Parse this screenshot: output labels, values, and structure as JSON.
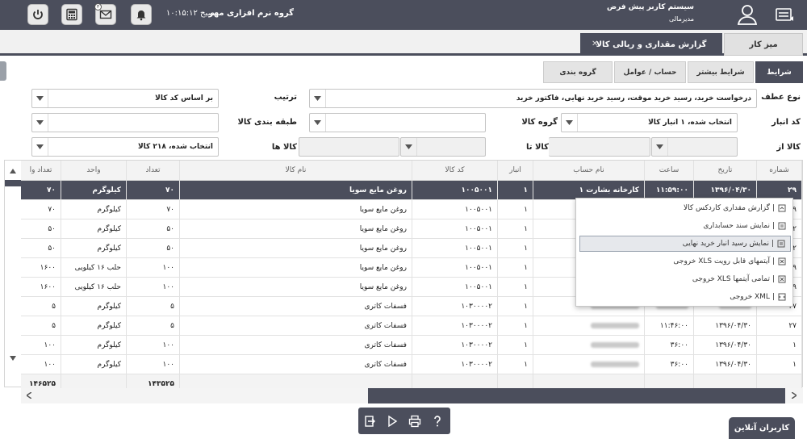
{
  "topbar": {
    "system_name": "سیستم کاربر پیش فرض",
    "role": "مدیرمالی",
    "company": "گروه نرم افزاری مهر",
    "clock": "۱۰:۱۵:۱۲ صبح",
    "mail_badge": "۳",
    "icons": [
      "power-icon",
      "calculator-icon",
      "mail-icon",
      "bell-icon",
      "user-icon",
      "menu-icon"
    ]
  },
  "tabs": {
    "desk": "میز کار",
    "report": "گزارش مقداری و ریالی کالا"
  },
  "subtabs": {
    "conditions": "شرایط",
    "more_conditions": "شرایط بیشتر",
    "accounts": "حساب / عوامل",
    "grouping": "گروه بندی"
  },
  "filters": {
    "reference_type_label": "نوع عطف",
    "reference_type_value": "درخواست خرید، رسید خرید موقت، رسید خرید نهایی، فاکتور خرید",
    "sort_label": "ترتیب",
    "sort_value": "بر اساس کد کالا",
    "warehouse_label": "کد انبار",
    "warehouse_value": "انتخاب شده، ۱ انبار کالا",
    "group_label": "گروه کالا",
    "category_label": "طبقه بندی کالا",
    "item_from_label": "کالا از",
    "item_from_value": "",
    "item_to_label": "کالا تا",
    "items_label": "کالا ها",
    "items_value": "انتخاب شده، ۲۱۸ کالا"
  },
  "grid": {
    "headers": [
      "شماره",
      "تاریخ",
      "ساعت",
      "نام حساب",
      "انبار",
      "کد کالا",
      "نام کالا",
      "تعداد",
      "واحد",
      "تعداد وا"
    ],
    "rows": [
      {
        "no": "۲۹",
        "date": "۱۳۹۶/۰۴/۳۰",
        "time": "۱۱:۵۹:۰۰",
        "account": "کارخانه بشارت ۱",
        "wh": "۱",
        "code": "۱۰۰۵۰۰۱",
        "name": "روغن مایع سویا",
        "qty": "۷۰",
        "unit": "کیلوگرم",
        "qty2": "۷۰"
      },
      {
        "no": "۲۹",
        "date": "",
        "time": "",
        "account": "",
        "wh": "۱",
        "code": "۱۰۰۵۰۰۱",
        "name": "روغن مایع سویا",
        "qty": "۷۰",
        "unit": "کیلوگرم",
        "qty2": "۷۰"
      },
      {
        "no": "۳۲",
        "date": "",
        "time": "",
        "account": "",
        "wh": "۱",
        "code": "۱۰۰۵۰۰۱",
        "name": "روغن مایع سویا",
        "qty": "۵۰",
        "unit": "کیلوگرم",
        "qty2": "۵۰"
      },
      {
        "no": "۳۲",
        "date": "",
        "time": "",
        "account": "",
        "wh": "۱",
        "code": "۱۰۰۵۰۰۱",
        "name": "روغن مایع سویا",
        "qty": "۵۰",
        "unit": "کیلوگرم",
        "qty2": "۵۰"
      },
      {
        "no": "۲۹",
        "date": "",
        "time": "",
        "account": "اب(کرمی)",
        "wh": "۱",
        "code": "۱۰۰۵۰۰۱",
        "name": "روغن مایع سویا",
        "qty": "۱۰۰",
        "unit": "حلب ۱۶ کیلویی",
        "qty2": "۱۶۰۰"
      },
      {
        "no": "۲۹",
        "date": "",
        "time": "",
        "account": "اب(کرمی)",
        "wh": "۱",
        "code": "۱۰۰۵۰۰۱",
        "name": "روغن مایع سویا",
        "qty": "۱۰۰",
        "unit": "حلب ۱۶ کیلویی",
        "qty2": "۱۶۰۰"
      },
      {
        "no": "۲۷",
        "date": "",
        "time": "",
        "account": "",
        "wh": "۱",
        "code": "۱۰۳۰۰۰۰۲",
        "name": "فسفات کاتری",
        "qty": "۵",
        "unit": "کیلوگرم",
        "qty2": "۵"
      },
      {
        "no": "۲۷",
        "date": "۱۳۹۶/۰۴/۳۰",
        "time": "۱۱:۴۶:۰۰",
        "account": "",
        "wh": "۱",
        "code": "۱۰۳۰۰۰۰۲",
        "name": "فسفات کاتری",
        "qty": "۵",
        "unit": "کیلوگرم",
        "qty2": "۵"
      },
      {
        "no": "۱",
        "date": "۱۳۹۶/۰۴/۳۰",
        "time": "۳۶:۰۰",
        "account": "",
        "wh": "۱",
        "code": "۱۰۳۰۰۰۰۲",
        "name": "فسفات کاتری",
        "qty": "۱۰۰",
        "unit": "کیلوگرم",
        "qty2": "۱۰۰"
      },
      {
        "no": "۱",
        "date": "۱۳۹۶/۰۴/۳۰",
        "time": "۳۶:۰۰",
        "account": "",
        "wh": "۱",
        "code": "۱۰۳۰۰۰۰۲",
        "name": "فسفات کاتری",
        "qty": "۱۰۰",
        "unit": "کیلوگرم",
        "qty2": "۱۰۰"
      }
    ],
    "totals": {
      "qty": "۱۴۳۵۲۵",
      "qty2": "۱۴۶۵۲۵"
    }
  },
  "context_menu": {
    "items": [
      "گزارش مقداری کاردکس کالا",
      "نمایش سند حسابداری",
      "نمایش رسید انبار خرید نهایی",
      "خروجی XLS آیتمهای قابل رویت",
      "خروجی XLS تمامی آیتمها",
      "خروجی XML"
    ]
  },
  "footer": {
    "online_users": "کاربران آنلاین"
  },
  "colors": {
    "primary": "#4b4e5c",
    "header_bg": "#f3f3f3",
    "highlight": "#e6e8ec"
  }
}
